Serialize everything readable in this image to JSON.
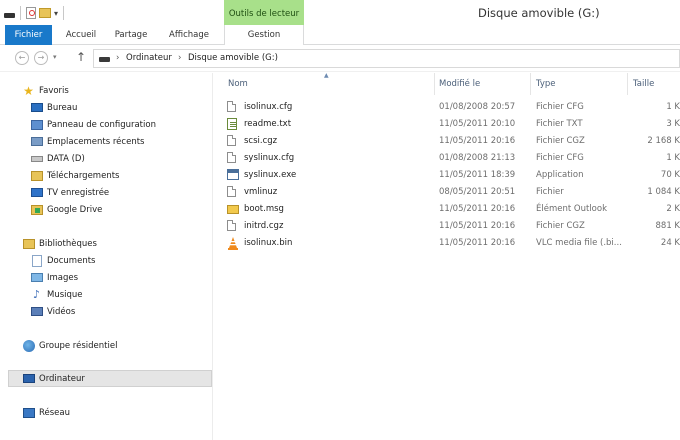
{
  "window": {
    "title": "Disque amovible (G:)",
    "context_group": "Outils de lecteur"
  },
  "tabs": [
    {
      "label": "Fichier"
    },
    {
      "label": "Accueil"
    },
    {
      "label": "Partage"
    },
    {
      "label": "Affichage"
    },
    {
      "label": "Gestion"
    }
  ],
  "address": {
    "crumbs": [
      "Ordinateur",
      "Disque amovible (G:)"
    ]
  },
  "nav": {
    "favorites": "Favoris",
    "favorite_items": [
      "Bureau",
      "Panneau de configuration",
      "Emplacements récents",
      "DATA (D)",
      "Téléchargements",
      "TV enregistrée",
      "Google Drive"
    ],
    "libraries": "Bibliothèques",
    "library_items": [
      "Documents",
      "Images",
      "Musique",
      "Vidéos"
    ],
    "homegroup": "Groupe résidentiel",
    "computer": "Ordinateur",
    "network": "Réseau"
  },
  "columns": {
    "name": "Nom",
    "modified": "Modifié le",
    "type": "Type",
    "size": "Taille"
  },
  "files": [
    {
      "name": "isolinux.cfg",
      "modified": "01/08/2008 20:57",
      "type": "Fichier CFG",
      "size": "1 K",
      "icon": "generic-file-icon"
    },
    {
      "name": "readme.txt",
      "modified": "11/05/2011 20:10",
      "type": "Fichier TXT",
      "size": "3 K",
      "icon": "text-file-icon"
    },
    {
      "name": "scsi.cgz",
      "modified": "11/05/2011 20:16",
      "type": "Fichier CGZ",
      "size": "2 168 K",
      "icon": "generic-file-icon"
    },
    {
      "name": "syslinux.cfg",
      "modified": "01/08/2008 21:13",
      "type": "Fichier CFG",
      "size": "1 K",
      "icon": "generic-file-icon"
    },
    {
      "name": "syslinux.exe",
      "modified": "11/05/2011 18:39",
      "type": "Application",
      "size": "70 K",
      "icon": "application-icon"
    },
    {
      "name": "vmlinuz",
      "modified": "08/05/2011 20:51",
      "type": "Fichier",
      "size": "1 084 K",
      "icon": "generic-file-icon"
    },
    {
      "name": "boot.msg",
      "modified": "11/05/2011 20:16",
      "type": "Élément Outlook",
      "size": "2 K",
      "icon": "outlook-message-icon"
    },
    {
      "name": "initrd.cgz",
      "modified": "11/05/2011 20:16",
      "type": "Fichier CGZ",
      "size": "881 K",
      "icon": "generic-file-icon"
    },
    {
      "name": "isolinux.bin",
      "modified": "11/05/2011 20:16",
      "type": "VLC media file (.bi...",
      "size": "24 K",
      "icon": "vlc-cone-icon"
    }
  ],
  "colors": {
    "file_tab": "#1979ca",
    "context_tab": "#a8e08a",
    "header_text": "#4c607a"
  }
}
